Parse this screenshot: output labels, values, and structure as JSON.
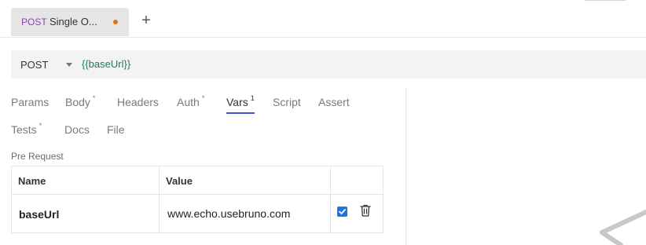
{
  "tabbar": {
    "request_tab": {
      "method": "POST",
      "name": "Single O...",
      "unsaved": true
    },
    "new_tab_label": "+"
  },
  "urlbar": {
    "method": "POST",
    "url": "{{baseUrl}}"
  },
  "subtabs": [
    {
      "label": "Params",
      "marker": ""
    },
    {
      "label": "Body",
      "marker": "*"
    },
    {
      "label": "Headers",
      "marker": ""
    },
    {
      "label": "Auth",
      "marker": "*"
    },
    {
      "label": "Vars",
      "marker": "1",
      "active": true
    },
    {
      "label": "Script",
      "marker": ""
    },
    {
      "label": "Assert",
      "marker": ""
    },
    {
      "label": "Tests",
      "marker": "*"
    },
    {
      "label": "Docs",
      "marker": ""
    },
    {
      "label": "File",
      "marker": ""
    }
  ],
  "vars": {
    "section_label": "Pre Request",
    "columns": {
      "name": "Name",
      "value": "Value"
    },
    "rows": [
      {
        "name": "baseUrl",
        "value": "www.echo.usebruno.com",
        "enabled": true
      }
    ]
  },
  "colors": {
    "post_method": "#8e44ad",
    "url_var": "#1e7d54",
    "active_tab_underline": "#4659d4",
    "unsaved_dot": "#d97706"
  },
  "icons": {
    "new_tab": "plus-icon",
    "method_dropdown": "chevron-down-icon",
    "delete": "trash-icon"
  }
}
